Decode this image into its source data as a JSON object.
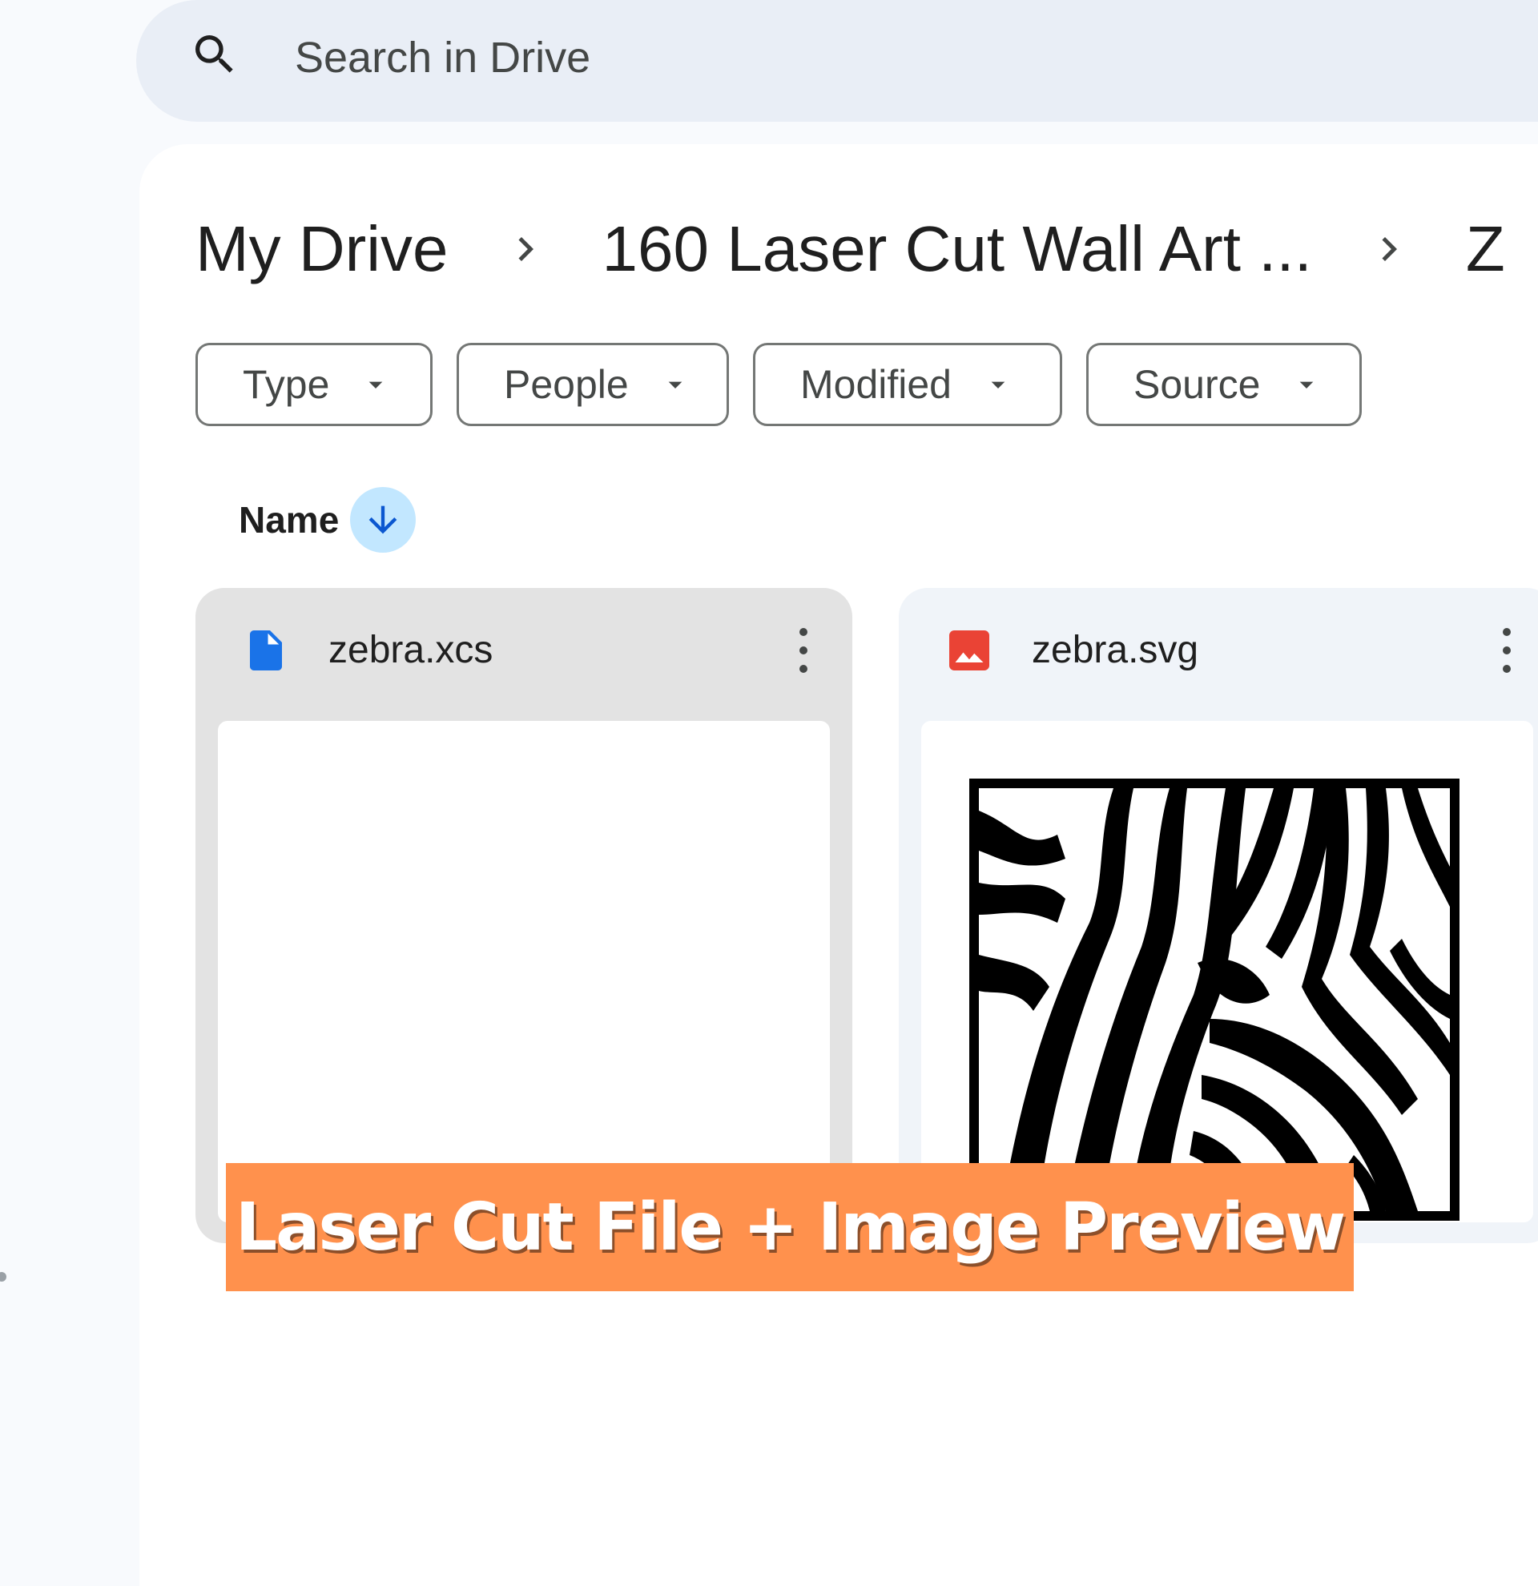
{
  "search": {
    "placeholder": "Search in Drive",
    "icon": "search-icon"
  },
  "breadcrumb": {
    "items": [
      "My Drive",
      "160 Laser Cut Wall Art ...",
      "Z"
    ]
  },
  "filters": [
    {
      "label": "Type"
    },
    {
      "label": "People"
    },
    {
      "label": "Modified"
    },
    {
      "label": "Source"
    }
  ],
  "sort": {
    "label": "Name",
    "direction": "descending",
    "icon": "arrow-down-icon"
  },
  "files": [
    {
      "name": "zebra.xcs",
      "icon": "doc-file-icon",
      "icon_color": "#1a73e8",
      "selected": true,
      "preview": "blank"
    },
    {
      "name": "zebra.svg",
      "icon": "image-file-icon",
      "icon_color": "#ea4335",
      "selected": false,
      "preview": "zebra stripe image"
    }
  ],
  "caption": {
    "text": "Laser Cut File + Image Preview",
    "background": "#ff914d"
  },
  "colors": {
    "page_bg": "#f8fafd",
    "search_bg": "#e9eef6",
    "sort_toggle_bg": "#c2e7ff",
    "sort_arrow": "#0b57d0",
    "selected_card_bg": "#e3e3e3",
    "card_bg": "#f0f4f9"
  }
}
